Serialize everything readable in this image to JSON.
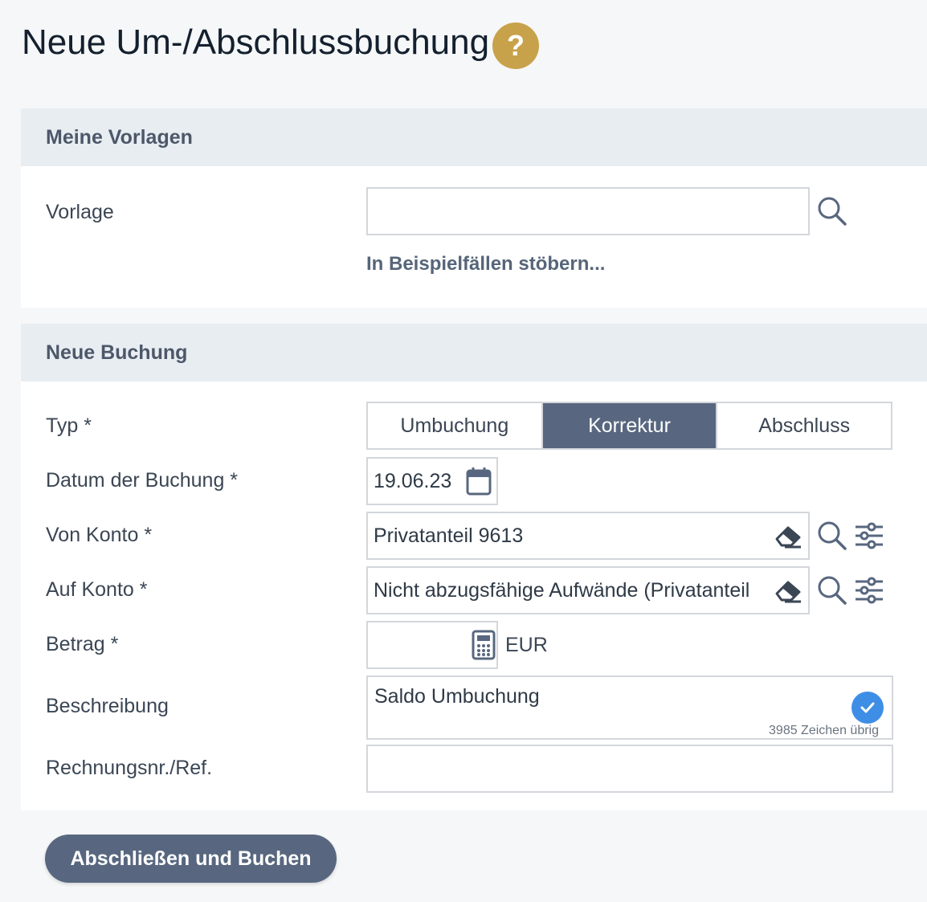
{
  "page": {
    "title": "Neue Um-/Abschlussbuchung",
    "help_label": "?"
  },
  "templates": {
    "header": "Meine Vorlagen",
    "vorlage_label": "Vorlage",
    "vorlage_value": "",
    "browse_link": "In Beispielfällen stöbern..."
  },
  "booking": {
    "header": "Neue Buchung",
    "typ_label": "Typ *",
    "typ_options": [
      "Umbuchung",
      "Korrektur",
      "Abschluss"
    ],
    "typ_selected": "Korrektur",
    "datum_label": "Datum der Buchung *",
    "datum_value": "19.06.23",
    "von_label": "Von Konto *",
    "von_value": "Privatanteil 9613",
    "auf_label": "Auf Konto *",
    "auf_value": "Nicht abzugsfähige Aufwände (Privatanteil",
    "betrag_label": "Betrag *",
    "betrag_value": "",
    "currency": "EUR",
    "beschreibung_label": "Beschreibung",
    "beschreibung_value": "Saldo Umbuchung",
    "chars_left": "3985 Zeichen übrig",
    "rechnung_label": "Rechnungsnr./Ref.",
    "rechnung_value": ""
  },
  "actions": {
    "submit_label": "Abschließen und Buchen"
  },
  "colors": {
    "accent": "#58677f",
    "help": "#c8a24a",
    "check": "#3e8ee6"
  }
}
